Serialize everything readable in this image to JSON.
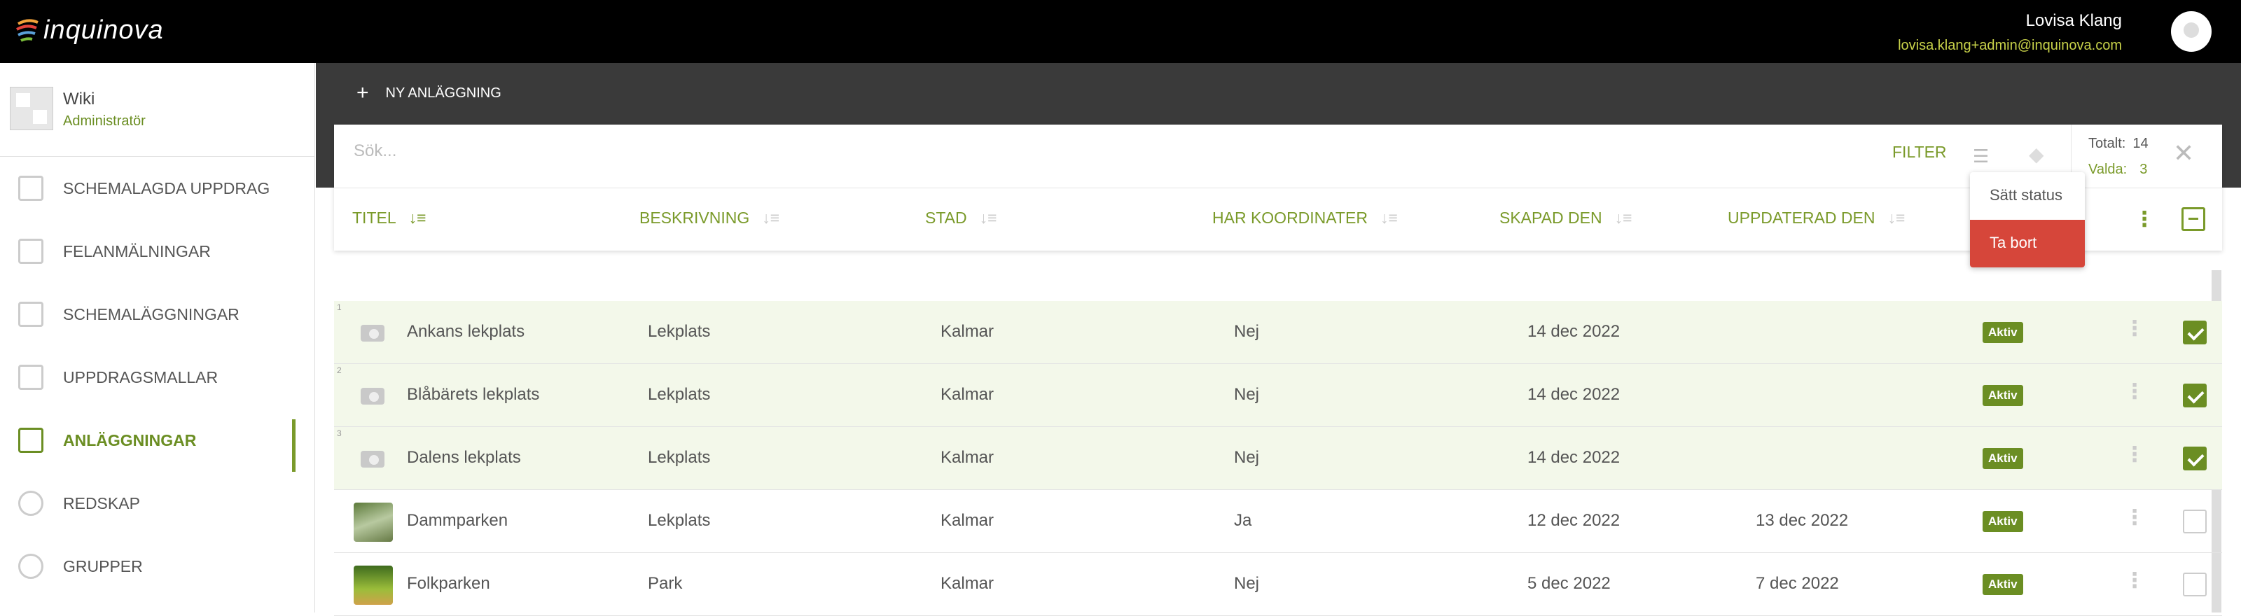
{
  "topbar": {
    "logo": "inquinova",
    "user_name": "Lovisa Klang",
    "user_email": "lovisa.klang+admin@inquinova.com"
  },
  "sidebar": {
    "org_name": "Wiki",
    "org_role": "Administratör",
    "items": [
      {
        "label": "SCHEMALAGDA UPPDRAG",
        "icon": "clipboard-icon"
      },
      {
        "label": "FELANMÄLNINGAR",
        "icon": "report-icon"
      },
      {
        "label": "SCHEMALÄGGNINGAR",
        "icon": "calendar-icon"
      },
      {
        "label": "UPPDRAGSMALLAR",
        "icon": "columns-icon"
      },
      {
        "label": "ANLÄGGNINGAR",
        "icon": "building-icon",
        "active": true
      },
      {
        "label": "REDSKAP",
        "icon": "balloon-icon"
      },
      {
        "label": "GRUPPER",
        "icon": "users-icon"
      }
    ]
  },
  "toolbar": {
    "new_label": "NY ANLÄGGNING"
  },
  "search": {
    "placeholder": "Sök..."
  },
  "filter": {
    "label": "FILTER"
  },
  "totals": {
    "total_label": "Totalt:",
    "total_value": "14",
    "selected_label": "Valda:",
    "selected_value": "3"
  },
  "columns": [
    "TITEL",
    "BESKRIVNING",
    "STAD",
    "HAR KOORDINATER",
    "SKAPAD DEN",
    "UPPDATERAD DEN"
  ],
  "dropdown": {
    "set_status": "Sätt status",
    "delete": "Ta bort"
  },
  "rows": [
    {
      "num": "1",
      "title": "Ankans lekplats",
      "desc": "Lekplats",
      "city": "Kalmar",
      "coords": "Nej",
      "created": "14 dec 2022",
      "updated": "",
      "status": "Aktiv",
      "selected": true,
      "thumb": "camera-icon"
    },
    {
      "num": "2",
      "title": "Blåbärets lekplats",
      "desc": "Lekplats",
      "city": "Kalmar",
      "coords": "Nej",
      "created": "14 dec 2022",
      "updated": "",
      "status": "Aktiv",
      "selected": true,
      "thumb": "camera-icon"
    },
    {
      "num": "3",
      "title": "Dalens lekplats",
      "desc": "Lekplats",
      "city": "Kalmar",
      "coords": "Nej",
      "created": "14 dec 2022",
      "updated": "",
      "status": "Aktiv",
      "selected": true,
      "thumb": "camera-icon"
    },
    {
      "num": "",
      "title": "Dammparken",
      "desc": "Lekplats",
      "city": "Kalmar",
      "coords": "Ja",
      "created": "12 dec 2022",
      "updated": "13 dec 2022",
      "status": "Aktiv",
      "selected": false,
      "thumb": "photo"
    },
    {
      "num": "",
      "title": "Folkparken",
      "desc": "Park",
      "city": "Kalmar",
      "coords": "Nej",
      "created": "5 dec 2022",
      "updated": "7 dec 2022",
      "status": "Aktiv",
      "selected": false,
      "thumb": "photo"
    }
  ],
  "colors": {
    "accent": "#6b8e23",
    "danger": "#d6463a",
    "topbar": "#000000",
    "band": "#3a3a3a"
  }
}
